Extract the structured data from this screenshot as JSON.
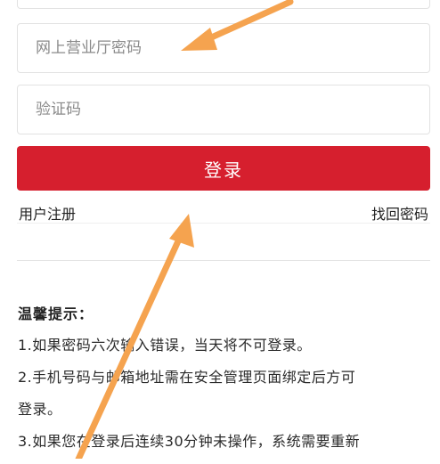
{
  "form": {
    "password_placeholder": "网上营业厅密码",
    "captcha_placeholder": "验证码",
    "login_label": "登录"
  },
  "links": {
    "register": "用户注册",
    "forgot_password": "找回密码"
  },
  "tips": {
    "title": "温馨提示：",
    "lines": [
      "1.如果密码六次输入错误，当天将不可登录。",
      "2.手机号码与邮箱地址需在安全管理页面绑定后方可",
      "登录。",
      "3.如果您在登录后连续30分钟未操作，系统需要重新"
    ]
  },
  "colors": {
    "accent": "#d61f2e",
    "annotation_arrow": "#f5a34f",
    "border": "#e2e2e2"
  }
}
